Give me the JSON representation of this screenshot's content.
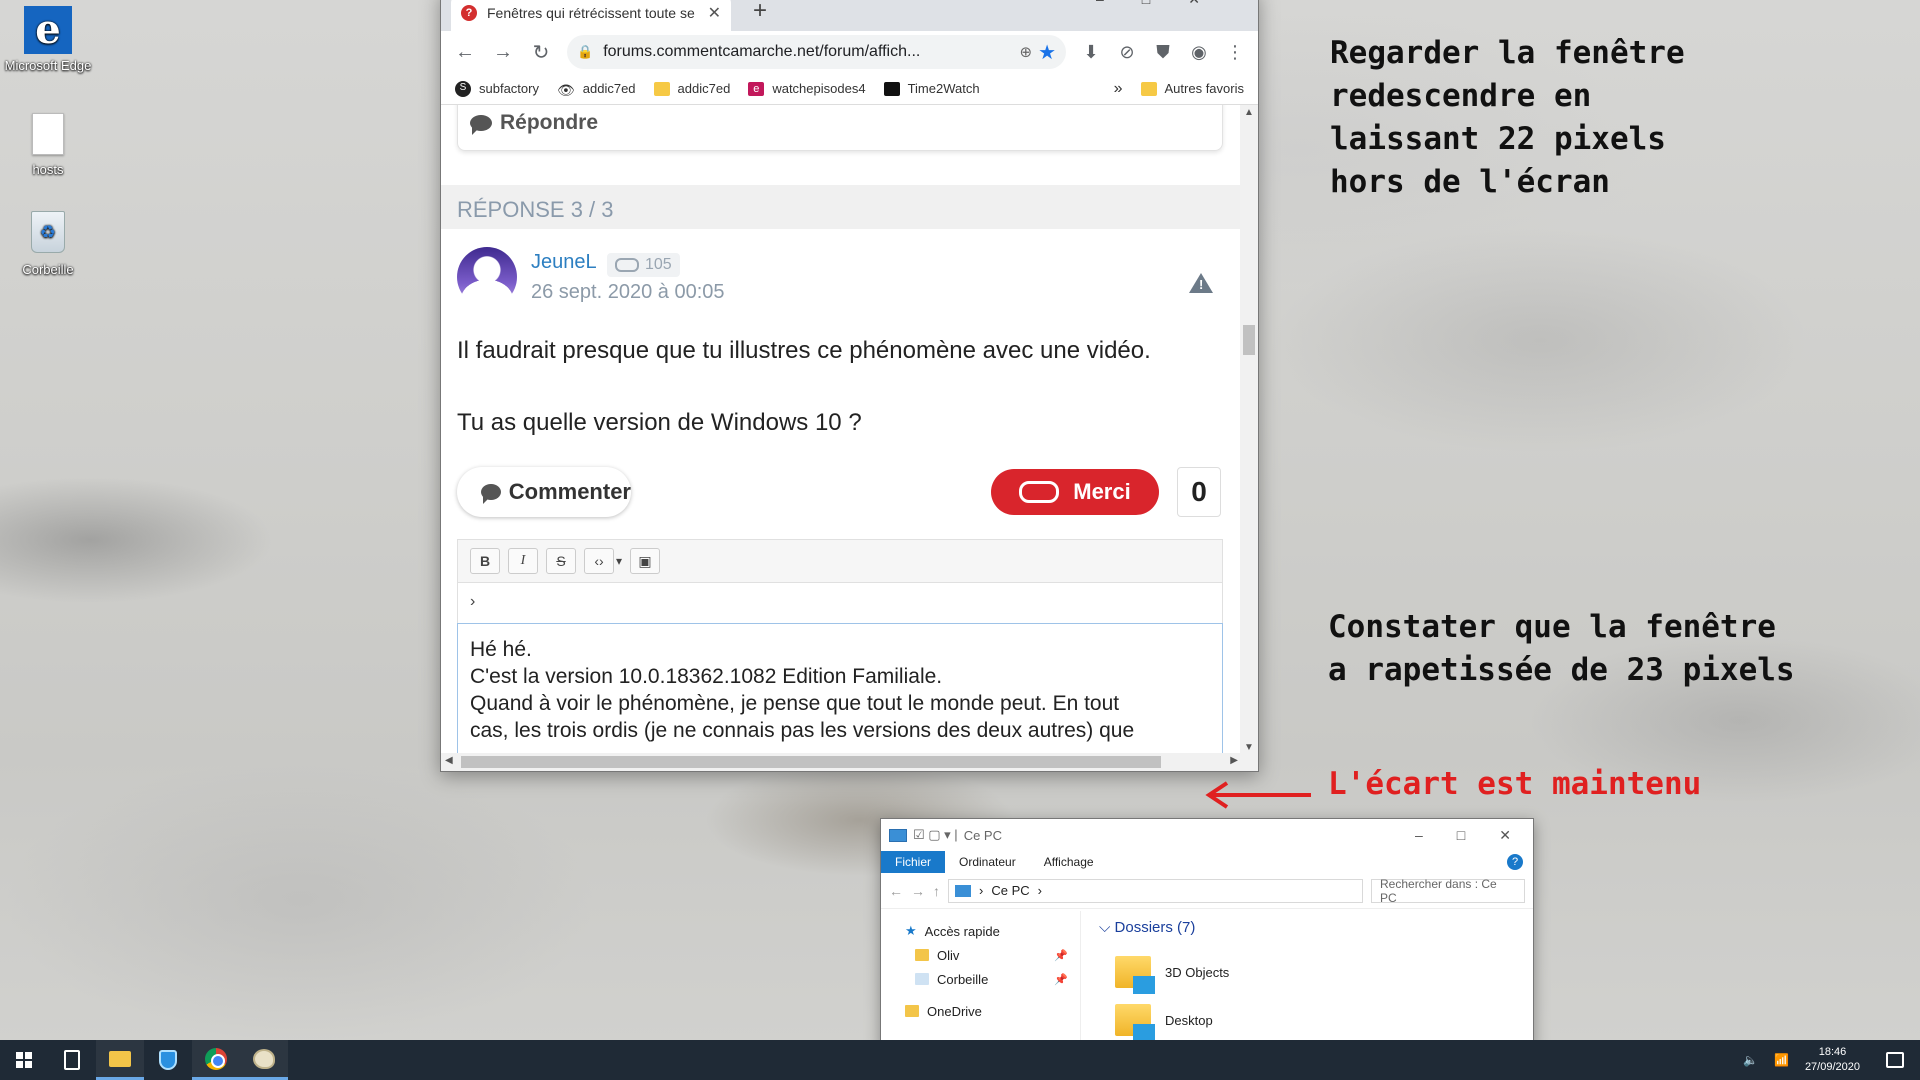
{
  "desktop": {
    "icons": [
      {
        "label": "Microsoft Edge",
        "icon": "edge-icon"
      },
      {
        "label": "hosts",
        "icon": "file-icon"
      },
      {
        "label": "Corbeille",
        "icon": "recycle-bin-icon"
      }
    ]
  },
  "browser": {
    "tab_title": "Fenêtres qui rétrécissent toute se",
    "new_tab": "+",
    "url": "forums.commentcamarche.net/forum/affich...",
    "bookmarks": [
      "subfactory",
      "addic7ed",
      "addic7ed",
      "watchepisodes4",
      "Time2Watch"
    ],
    "bookmarks_more": "»",
    "other_bookmarks": "Autres favoris",
    "page": {
      "reply_button": "Répondre",
      "answer_header": "RÉPONSE 3 / 3",
      "author": "JeuneL",
      "reputation": "105",
      "date": "26 sept. 2020 à 00:05",
      "message_line1": "Il faudrait presque que tu illustres ce phénomène avec une vidéo.",
      "message_line2": "Tu as quelle version de Windows 10 ?",
      "comment_button": "Commenter",
      "thanks_button": "Merci",
      "thanks_count": "0",
      "editor_tools": [
        "B",
        "I",
        "S",
        "‹›",
        "▾"
      ],
      "editor_path": "›",
      "editor_text": [
        "Hé hé.",
        "C'est la version 10.0.18362.1082 Edition Familiale.",
        "Quand à voir le phénomène, je pense que tout le monde peut. En tout",
        "cas, les trois ordis (je ne connais pas les versions des deux autres) que"
      ]
    }
  },
  "annotations": {
    "top": "Regarder la fenêtre\nredescendre en\nlaissant 22 pixels\nhors de l'écran",
    "middle": "Constater que la fenêtre\na rapetissée de 23 pixels",
    "gap": "L'écart est maintenu",
    "gap_color": "#e02020"
  },
  "explorer": {
    "title": "Ce PC",
    "ribbon_tabs": [
      "Fichier",
      "Ordinateur",
      "Affichage"
    ],
    "breadcrumb": "Ce PC",
    "search_placeholder": "Rechercher dans : Ce PC",
    "nav": {
      "quick_access": "Accès rapide",
      "items": [
        "Oliv",
        "Corbeille"
      ],
      "onedrive": "OneDrive"
    },
    "group_header": "Dossiers (7)",
    "folders": [
      "3D Objects",
      "Desktop"
    ]
  },
  "taskbar": {
    "apps": [
      "start-icon",
      "calculator-icon",
      "file-explorer-icon",
      "security-icon",
      "chrome-icon",
      "paint-icon"
    ],
    "time": "18:46",
    "date": "27/09/2020"
  }
}
